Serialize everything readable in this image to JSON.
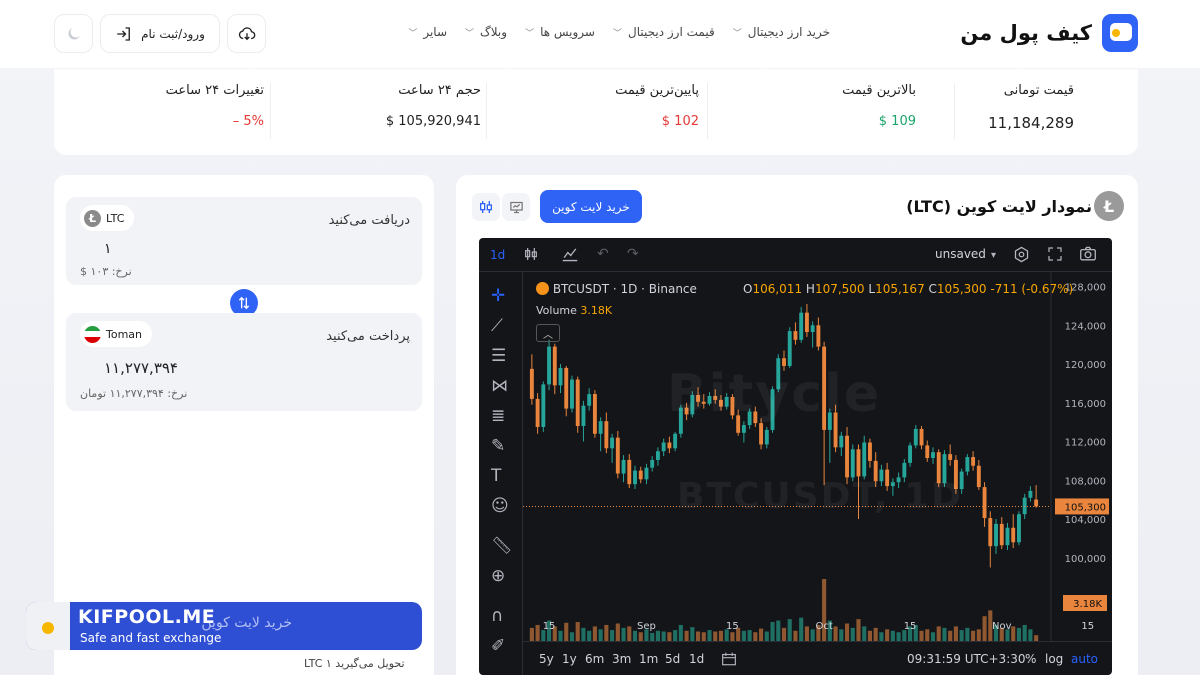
{
  "nav": {
    "logo_text": "کیف پول من",
    "menu": [
      {
        "label": "خرید ارز دیجیتال"
      },
      {
        "label": "قیمت ارز دیجیتال"
      },
      {
        "label": "سرویس ها"
      },
      {
        "label": "وبلاگ"
      },
      {
        "label": "سایر"
      }
    ],
    "login_label": "ورود/ثبت نام"
  },
  "stats": {
    "toman_price": {
      "label": "قیمت تومانی",
      "value": "11,184,289"
    },
    "highest": {
      "label": "بالاترین قیمت",
      "value": "109 $"
    },
    "lowest": {
      "label": "پایین‌ترین قیمت",
      "value": "102 $"
    },
    "volume": {
      "label": "حجم ۲۴ ساعت",
      "value": "105,920,941 $"
    },
    "change": {
      "label": "تغییرات ۲۴ ساعت",
      "value": "5% –"
    }
  },
  "converter": {
    "receive_label": "دریافت می‌کنید",
    "receive_coin": "LTC",
    "receive_amount": "۱",
    "receive_rate": "نرخ: ۱۰۳ $",
    "pay_label": "پرداخت می‌کنید",
    "pay_coin": "Toman",
    "pay_amount": "۱۱,۲۷۷,۳۹۴",
    "pay_rate": "نرخ: ۱۱,۲۷۷,۳۹۴ تومان",
    "buy_label": "خرید لایت کوین",
    "delivery": "تحویل می‌گیرید ۱ LTC"
  },
  "brand": {
    "name": "KIFPOOL.ME",
    "tagline": "Safe and fast exchange"
  },
  "chart_panel": {
    "title": "نمودار لایت کوین (LTC)",
    "buy_label": "خرید لایت کوین"
  },
  "tv": {
    "interval": "1d",
    "unsaved": "unsaved",
    "symbol": "BTCUSDT · 1D · Binance",
    "ohlc": {
      "o": "106,011",
      "h": "107,500",
      "l": "105,167",
      "c": "105,300",
      "chg": "-711 (-0.67%)"
    },
    "volume_label": "Volume",
    "volume_value": "3.18K",
    "watermark": "Bitycle",
    "watermark2": "BTCUSDT, 1D",
    "ranges": [
      "5y",
      "1y",
      "6m",
      "3m",
      "1m",
      "5d",
      "1d"
    ],
    "time": "09:31:59 UTC+3:30",
    "opts": [
      "%",
      "log",
      "auto"
    ],
    "colors": {
      "up": "#26a69a",
      "down": "#e9853c",
      "price_line": "#e9853c"
    }
  },
  "chart_data": {
    "type": "candlestick",
    "title": "BTCUSDT · 1D · Binance",
    "y_ticks": [
      128000,
      124000,
      120000,
      116000,
      112000,
      108000,
      104000,
      100000
    ],
    "ylim": [
      97500,
      129500
    ],
    "last_price": 105300,
    "last_price_label": "105,300",
    "volume_label": "3.18K",
    "x_ticks": [
      {
        "label": "15",
        "index": 3
      },
      {
        "label": "Sep",
        "index": 20
      },
      {
        "label": "15",
        "index": 35
      },
      {
        "label": "Oct",
        "index": 51
      },
      {
        "label": "15",
        "index": 66
      },
      {
        "label": "Nov",
        "index": 82
      },
      {
        "label": "15",
        "index": 97
      }
    ],
    "candles": [
      [
        119500,
        121000,
        115800,
        116400
      ],
      [
        116400,
        117000,
        112800,
        113500
      ],
      [
        113500,
        118200,
        113000,
        117900
      ],
      [
        117900,
        122500,
        117300,
        121800
      ],
      [
        121800,
        122100,
        116900,
        117800
      ],
      [
        117800,
        120000,
        117000,
        119600
      ],
      [
        119600,
        119800,
        114600,
        115400
      ],
      [
        115400,
        118800,
        115000,
        118400
      ],
      [
        118400,
        118700,
        112900,
        113600
      ],
      [
        113600,
        116200,
        112000,
        115700
      ],
      [
        115700,
        117500,
        115200,
        116900
      ],
      [
        116900,
        117300,
        112400,
        112800
      ],
      [
        112800,
        114500,
        111000,
        114100
      ],
      [
        114100,
        115000,
        110800,
        111300
      ],
      [
        111300,
        112800,
        109800,
        112400
      ],
      [
        112400,
        113100,
        108200,
        108700
      ],
      [
        108700,
        110600,
        107800,
        110100
      ],
      [
        110100,
        110700,
        107200,
        107600
      ],
      [
        107600,
        109500,
        107100,
        109000
      ],
      [
        109000,
        109400,
        107700,
        108100
      ],
      [
        108100,
        109700,
        107600,
        109300
      ],
      [
        109300,
        110500,
        108900,
        110100
      ],
      [
        110100,
        111400,
        109500,
        111000
      ],
      [
        111000,
        112300,
        110500,
        111900
      ],
      [
        111900,
        112500,
        110800,
        111300
      ],
      [
        111300,
        113000,
        111000,
        112800
      ],
      [
        112800,
        115800,
        112400,
        115500
      ],
      [
        115500,
        116000,
        114200,
        114800
      ],
      [
        114800,
        117200,
        114500,
        116800
      ],
      [
        116800,
        117600,
        115600,
        116100
      ],
      [
        116100,
        116900,
        115400,
        115900
      ],
      [
        115900,
        117100,
        115700,
        116700
      ],
      [
        116700,
        117400,
        115900,
        116300
      ],
      [
        116300,
        116800,
        115200,
        115600
      ],
      [
        115600,
        117000,
        115300,
        116600
      ],
      [
        116600,
        116900,
        114300,
        114700
      ],
      [
        114700,
        115300,
        112600,
        112900
      ],
      [
        112900,
        114100,
        111900,
        113700
      ],
      [
        113700,
        115400,
        113300,
        115100
      ],
      [
        115100,
        115600,
        113500,
        113900
      ],
      [
        113900,
        114400,
        111200,
        111700
      ],
      [
        111700,
        113500,
        111300,
        113200
      ],
      [
        113200,
        117700,
        112900,
        117400
      ],
      [
        117400,
        121000,
        117100,
        120600
      ],
      [
        120600,
        121400,
        119300,
        119800
      ],
      [
        119800,
        123800,
        119600,
        123400
      ],
      [
        123400,
        124300,
        122000,
        122500
      ],
      [
        122500,
        125900,
        122200,
        125300
      ],
      [
        125300,
        126200,
        122800,
        123300
      ],
      [
        123300,
        124400,
        121700,
        124000
      ],
      [
        124000,
        124800,
        121400,
        121800
      ],
      [
        121800,
        122300,
        107500,
        113200
      ],
      [
        113200,
        115400,
        109800,
        115000
      ],
      [
        115000,
        115800,
        110900,
        111400
      ],
      [
        111400,
        113000,
        110500,
        112600
      ],
      [
        112600,
        113500,
        107600,
        108300
      ],
      [
        108300,
        111700,
        107900,
        111200
      ],
      [
        111200,
        111700,
        104000,
        108400
      ],
      [
        108400,
        112600,
        108100,
        111900
      ],
      [
        111900,
        112300,
        109300,
        110000
      ],
      [
        110000,
        110900,
        107300,
        107900
      ],
      [
        107900,
        109600,
        107400,
        109100
      ],
      [
        109100,
        109800,
        106900,
        107400
      ],
      [
        107400,
        108200,
        106400,
        107800
      ],
      [
        107800,
        108800,
        107200,
        108300
      ],
      [
        108300,
        110200,
        107800,
        109800
      ],
      [
        109800,
        111900,
        109400,
        111600
      ],
      [
        111600,
        113700,
        111300,
        113300
      ],
      [
        113300,
        113600,
        111200,
        111600
      ],
      [
        111600,
        112100,
        109900,
        110300
      ],
      [
        110300,
        111400,
        109700,
        110900
      ],
      [
        110900,
        111200,
        107300,
        107700
      ],
      [
        107700,
        111100,
        107300,
        110700
      ],
      [
        110700,
        111700,
        109500,
        110100
      ],
      [
        110100,
        110600,
        106600,
        107100
      ],
      [
        107100,
        109200,
        106600,
        108900
      ],
      [
        108900,
        110700,
        108500,
        110400
      ],
      [
        110400,
        111000,
        109000,
        109500
      ],
      [
        109500,
        110100,
        107000,
        107300
      ],
      [
        107300,
        107800,
        103200,
        104100
      ],
      [
        104100,
        104800,
        99000,
        101200
      ],
      [
        101200,
        104000,
        100400,
        103500
      ],
      [
        103500,
        104200,
        100900,
        101300
      ],
      [
        101300,
        103600,
        100800,
        103100
      ],
      [
        103100,
        104500,
        101000,
        101600
      ],
      [
        101600,
        104800,
        101300,
        104500
      ],
      [
        104500,
        106600,
        104000,
        106200
      ],
      [
        106200,
        107400,
        105800,
        106900
      ],
      [
        106011,
        107500,
        105167,
        105300
      ]
    ],
    "volume": [
      18,
      22,
      15,
      28,
      20,
      14,
      25,
      12,
      26,
      18,
      14,
      20,
      16,
      22,
      15,
      24,
      18,
      20,
      14,
      12,
      16,
      11,
      14,
      13,
      12,
      15,
      22,
      14,
      19,
      13,
      12,
      15,
      13,
      14,
      16,
      12,
      18,
      14,
      15,
      12,
      17,
      13,
      26,
      28,
      18,
      30,
      14,
      32,
      20,
      16,
      22,
      85,
      28,
      20,
      16,
      24,
      18,
      30,
      20,
      14,
      18,
      12,
      16,
      14,
      12,
      15,
      20,
      22,
      14,
      16,
      12,
      20,
      18,
      14,
      20,
      15,
      18,
      14,
      16,
      34,
      42,
      22,
      18,
      16,
      20,
      18,
      22,
      16,
      8
    ]
  }
}
